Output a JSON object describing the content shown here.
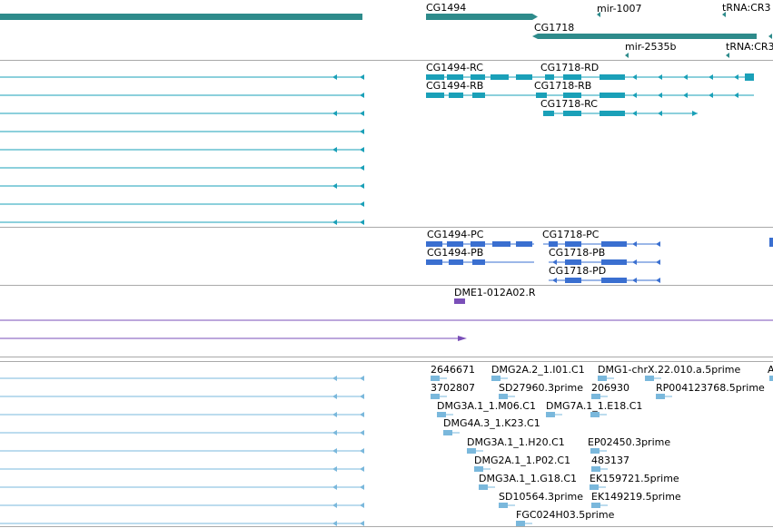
{
  "colors": {
    "gene": "#2e8b8b",
    "transcript": "#1aa0b8",
    "protein": "#3a6fd0",
    "oligo": "#7a4fb8",
    "est": "#7ab8dc",
    "divider": "#a9a9a9"
  },
  "tracks": {
    "genes": {
      "labels": [
        "CG1494",
        "mir-1007",
        "tRNA:CR3",
        "CG1718",
        "mir-2535b",
        "tRNA:CR3"
      ]
    },
    "transcripts": {
      "labels": [
        "CG1494-RC",
        "CG1718-RD",
        "CG1494-RB",
        "CG1718-RB",
        "CG1718-RC"
      ]
    },
    "proteins": {
      "labels": [
        "CG1494-PC",
        "CG1718-PC",
        "CG1494-PB",
        "CG1718-PB",
        "CG1718-PD"
      ]
    },
    "oligos": {
      "labels": [
        "DME1-012A02.R"
      ]
    },
    "ests": {
      "labels": [
        "2646671",
        "DMG2A.2_1.I01.C1",
        "DMG1-chrX.22.010.a.5prime",
        "A",
        "3702807",
        "SD27960.3prime",
        "206930",
        "RP004123768.5prime",
        "DMG3A.1_1.M06.C1",
        "DMG7A.1_1.E18.C1",
        "DMG4A.3_1.K23.C1",
        "DMG3A.1_1.H20.C1",
        "EP02450.3prime",
        "DMG2A.1_1.P02.C1",
        "483137",
        "DMG3A.1_1.G18.C1",
        "EK159721.5prime",
        "SD10564.3prime",
        "EK149219.5prime",
        "FGC024H03.5prime"
      ]
    }
  }
}
